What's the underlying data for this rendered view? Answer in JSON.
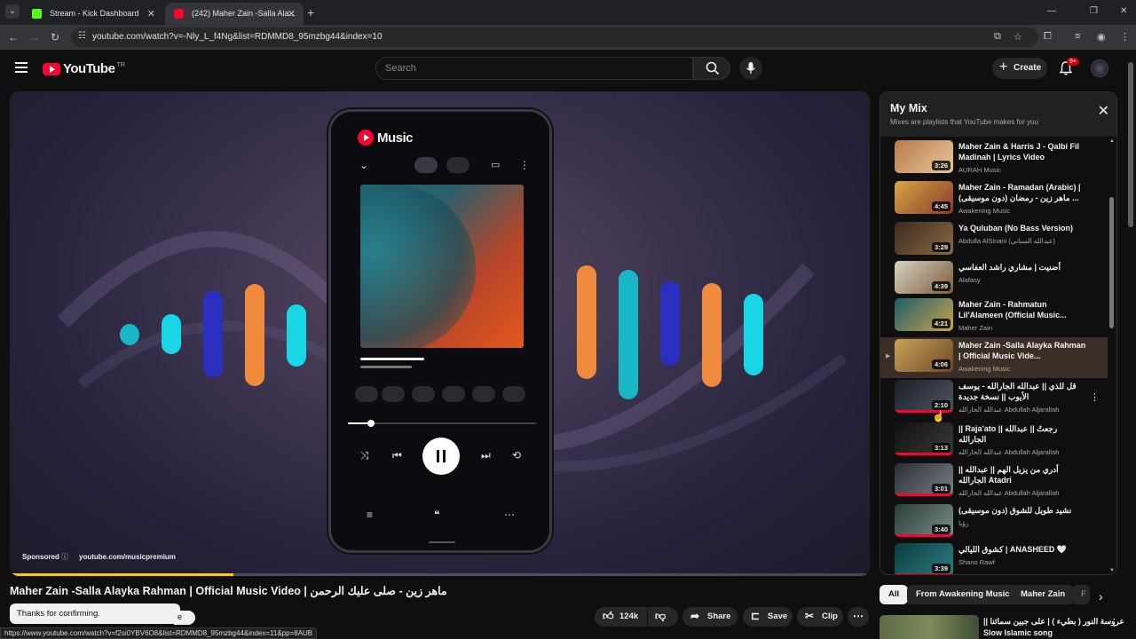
{
  "browser": {
    "tabs": [
      {
        "title": "Stream - Kick Dashboard",
        "favicon_color": "#53fc18"
      },
      {
        "title": "(242) Maher Zain -Salla Ala...",
        "favicon_color": "#ff0033"
      }
    ],
    "url": "youtube.com/watch?v=-Nly_L_f4Ng&list=RDMMD8_95mzbg44&index=10",
    "status_url": "https://www.youtube.com/watch?v=f2si0YBV6O8&list=RDMMD8_95mzbg44&index=11&pp=8AUB"
  },
  "header": {
    "logo_text": "YouTube",
    "country_code": "TR",
    "search_placeholder": "Search",
    "create_label": "Create",
    "notif_badge": "9+"
  },
  "player": {
    "sponsored_label": "Sponsored",
    "sponsored_url": "youtube.com/musicpremium",
    "music_app_label": "Music",
    "progress": 0.26
  },
  "video": {
    "title": "Maher Zain -Salla Alayka Rahman | Official Music Video | ماهر زين - صلى عليك الرحمن",
    "toast": "Thanks for confirming.",
    "toast_peek": "e",
    "likes": "124k",
    "share_label": "Share",
    "save_label": "Save",
    "clip_label": "Clip"
  },
  "mix": {
    "title": "My Mix",
    "subtitle": "Mixes are playlists that YouTube makes for you",
    "items": [
      {
        "title": "Maher Zain & Harris J - Qalbi Fil Madinah | Lyrics Video",
        "channel": "AURAH Music",
        "duration": "3:26",
        "colors": [
          "#b97a4a",
          "#e7c79b"
        ]
      },
      {
        "title": "Maher Zain - Ramadan (Arabic) | ماهر زين - رمضان (دون موسيقى) ...",
        "channel": "Awakening Music",
        "duration": "4:45",
        "colors": [
          "#d6a641",
          "#8a3b2b"
        ]
      },
      {
        "title": "Ya Quluban (No Bass Version)",
        "channel": "Abdulla AlSinani (عبدالله السناني)",
        "duration": "3:29",
        "colors": [
          "#3a2a1e",
          "#8c6a44"
        ]
      },
      {
        "title": "أضنيت | مشاري راشد العفاسي",
        "channel": "Alafasy",
        "duration": "4:39",
        "colors": [
          "#d9d2c4",
          "#7b5c3a"
        ]
      },
      {
        "title": "Maher Zain - Rahmatun Lil'Alameen (Official Music...",
        "channel": "Maher Zain",
        "duration": "4:21",
        "colors": [
          "#1e5f6b",
          "#c9a34c"
        ]
      },
      {
        "title": "Maher Zain -Salla Alayka Rahman | Official Music Vide...",
        "channel": "Awakening Music",
        "duration": "4:06",
        "colors": [
          "#caa15a",
          "#6b4a26"
        ]
      },
      {
        "title": "قل للذي || عبدالله الجارالله - يوسف الأيوب || نسخة جديدة",
        "channel": "عبدالله الجارالله  Abdullah Aljarallah",
        "duration": "2:10",
        "colors": [
          "#1b1f26",
          "#4d5662"
        ]
      },
      {
        "title": "|| Raja'ato || رجعتُ || عبدالله الجارالله",
        "channel": "عبدالله الجارالله  Abdullah Aljarallah",
        "duration": "3:13",
        "colors": [
          "#101010",
          "#3a3a3a"
        ]
      },
      {
        "title": "|| أدري من يزيل الهم || عبدالله الجارالله Atadri",
        "channel": "عبدالله الجارالله  Abdullah Aljarallah",
        "duration": "3:01",
        "colors": [
          "#2a2d33",
          "#7a7f88"
        ]
      },
      {
        "title": "نشيد طويل للشوق (دون موسيقى)",
        "channel": "رؤيا",
        "duration": "3:40",
        "colors": [
          "#2a3c3a",
          "#7a8f86"
        ]
      },
      {
        "title": "كشوق الليالي | ANASHEED 🤍",
        "channel": "Shano Rawf",
        "duration": "3:39",
        "colors": [
          "#0d3d40",
          "#2c7c80"
        ]
      }
    ],
    "active_index": 5
  },
  "chips": [
    "All",
    "From Awakening Music",
    "Maher Zain",
    "F"
  ],
  "recommended": {
    "title_line1": "|| عروسة النور ( بطيء ) | على جبين سمائنا",
    "title_line2": "Slow Islamic song"
  },
  "colors": {
    "accent": "#ff0033",
    "bar_teal": "#19c6d6",
    "bar_blue": "#2a2fc2",
    "bar_orange": "#f08a3c",
    "progress": "#ffcc00"
  }
}
